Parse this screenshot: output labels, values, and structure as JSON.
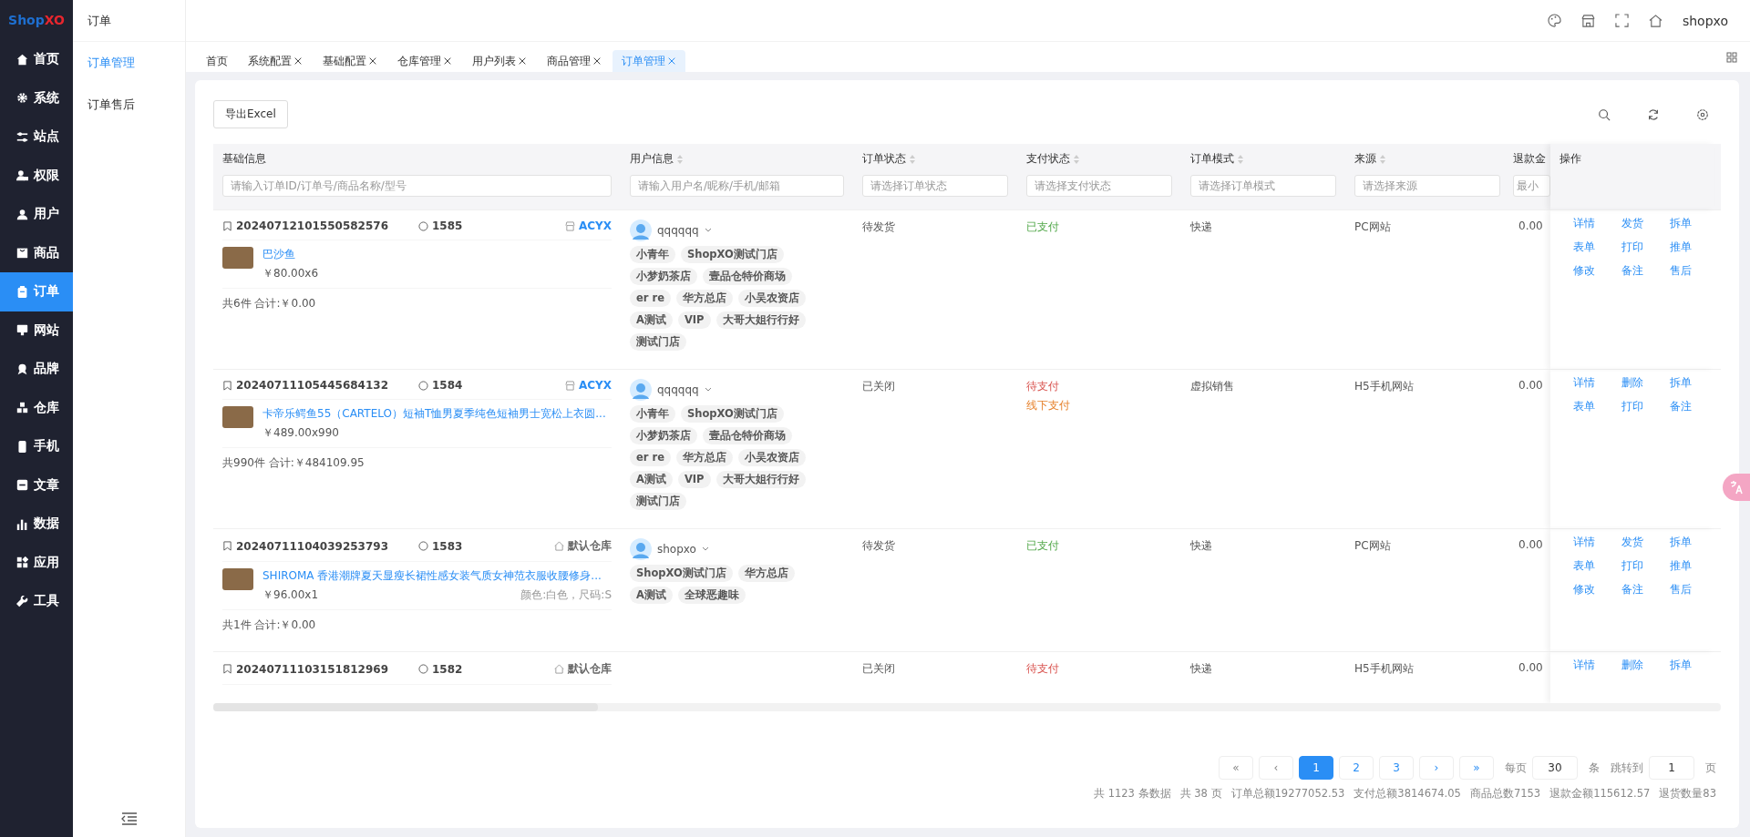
{
  "sidebar": {
    "logo": {
      "first": "Shop",
      "second": "XO"
    },
    "items": [
      {
        "label": "首页",
        "selected": false
      },
      {
        "label": "系统",
        "selected": false
      },
      {
        "label": "站点",
        "selected": false
      },
      {
        "label": "权限",
        "selected": false
      },
      {
        "label": "用户",
        "selected": false
      },
      {
        "label": "商品",
        "selected": false
      },
      {
        "label": "订单",
        "selected": true
      },
      {
        "label": "网站",
        "selected": false
      },
      {
        "label": "品牌",
        "selected": false
      },
      {
        "label": "仓库",
        "selected": false
      },
      {
        "label": "手机",
        "selected": false
      },
      {
        "label": "文章",
        "selected": false
      },
      {
        "label": "数据",
        "selected": false
      },
      {
        "label": "应用",
        "selected": false
      },
      {
        "label": "工具",
        "selected": false
      }
    ]
  },
  "subnav": {
    "title": "订单",
    "items": [
      {
        "label": "订单管理",
        "selected": true
      },
      {
        "label": "订单售后",
        "selected": false
      }
    ]
  },
  "header": {
    "user": "shopxo"
  },
  "tabs": [
    {
      "label": "首页",
      "closable": false,
      "selected": false
    },
    {
      "label": "系统配置",
      "closable": true,
      "selected": false
    },
    {
      "label": "基础配置",
      "closable": true,
      "selected": false
    },
    {
      "label": "仓库管理",
      "closable": true,
      "selected": false
    },
    {
      "label": "用户列表",
      "closable": true,
      "selected": false
    },
    {
      "label": "商品管理",
      "closable": true,
      "selected": false
    },
    {
      "label": "订单管理",
      "closable": true,
      "selected": true
    }
  ],
  "toolbar": {
    "export_button": "导出Excel"
  },
  "table": {
    "columns": [
      {
        "title": "基础信息",
        "sortable": false,
        "placeholder": "请输入订单ID/订单号/商品名称/型号"
      },
      {
        "title": "用户信息",
        "sortable": true,
        "placeholder": "请输入用户名/昵称/手机/邮箱"
      },
      {
        "title": "订单状态",
        "sortable": true,
        "placeholder": "请选择订单状态"
      },
      {
        "title": "支付状态",
        "sortable": true,
        "placeholder": "请选择支付状态"
      },
      {
        "title": "订单模式",
        "sortable": true,
        "placeholder": "请选择订单模式"
      },
      {
        "title": "来源",
        "sortable": true,
        "placeholder": "请选择来源"
      },
      {
        "title": "退款金",
        "sortable": false,
        "placeholder": "最小"
      },
      {
        "title": "操作",
        "sortable": false
      }
    ],
    "rows": [
      {
        "order_no": "20240712101550582576",
        "id": "1585",
        "warehouse": {
          "kind": "store",
          "name": "ACYX"
        },
        "goods": [
          {
            "title": "巴沙鱼",
            "price": "￥80.00x6"
          }
        ],
        "summary": "共6件 合计:￥0.00",
        "user": {
          "name": "qqqqqq",
          "tags": [
            "小青年",
            "ShopXO测试门店",
            "小梦奶茶店",
            "壹品仓特价商场",
            "er re",
            "华方总店",
            "小吴农资店",
            "A测试",
            "VIP",
            "大哥大姐行行好",
            "测试门店"
          ]
        },
        "status": "待发货",
        "payments": [
          {
            "text": "已支付",
            "color": "#52a84a"
          }
        ],
        "mode": "快递",
        "source": "PC网站",
        "refund": "0.00",
        "actions": [
          "详情",
          "发货",
          "拆单",
          "表单",
          "打印",
          "推单",
          "修改",
          "备注",
          "售后"
        ]
      },
      {
        "order_no": "20240711105445684132",
        "id": "1584",
        "warehouse": {
          "kind": "store",
          "name": "ACYX"
        },
        "goods": [
          {
            "title": "卡帝乐鳄鱼55（CARTELO）短袖T恤男夏季纯色短袖男士宽松上衣圆...",
            "price": "￥489.00x990"
          }
        ],
        "summary": "共990件 合计:￥484109.95",
        "user": {
          "name": "qqqqqq",
          "tags": [
            "小青年",
            "ShopXO测试门店",
            "小梦奶茶店",
            "壹品仓特价商场",
            "er re",
            "华方总店",
            "小吴农资店",
            "A测试",
            "VIP",
            "大哥大姐行行好",
            "测试门店"
          ]
        },
        "status": "已关闭",
        "payments": [
          {
            "text": "待支付",
            "color": "#d9534f"
          },
          {
            "text": "线下支付",
            "color": "#e6812b"
          }
        ],
        "mode": "虚拟销售",
        "source": "H5手机网站",
        "refund": "0.00",
        "actions": [
          "详情",
          "删除",
          "拆单",
          "表单",
          "打印",
          "备注"
        ]
      },
      {
        "order_no": "20240711104039253793",
        "id": "1583",
        "warehouse": {
          "kind": "house",
          "name": "默认仓库"
        },
        "goods": [
          {
            "title": "SHIROMA 香港潮牌夏天显瘦长裙性感女装气质女神范衣服收腰修身...",
            "price": "￥96.00x1",
            "spec": "颜色:白色，尺码:S"
          }
        ],
        "summary": "共1件 合计:￥0.00",
        "user": {
          "name": "shopxo",
          "tags": [
            "ShopXO测试门店",
            "华方总店",
            "A测试",
            "全球恶趣味"
          ]
        },
        "status": "待发货",
        "payments": [
          {
            "text": "已支付",
            "color": "#52a84a"
          }
        ],
        "mode": "快递",
        "source": "PC网站",
        "refund": "0.00",
        "actions": [
          "详情",
          "发货",
          "拆单",
          "表单",
          "打印",
          "推单",
          "修改",
          "备注",
          "售后"
        ]
      },
      {
        "order_no": "20240711103151812969",
        "id": "1582",
        "warehouse": {
          "kind": "house",
          "name": "默认仓库"
        },
        "status": "已关闭",
        "payments": [
          {
            "text": "待支付",
            "color": "#d9534f"
          }
        ],
        "mode": "快递",
        "source": "H5手机网站",
        "refund": "0.00",
        "actions": [
          "详情",
          "删除",
          "拆单"
        ]
      }
    ]
  },
  "pagination": {
    "buttons": [
      {
        "label": "«",
        "selected": false
      },
      {
        "label": "‹",
        "selected": false
      },
      {
        "label": "1",
        "selected": true
      },
      {
        "label": "2",
        "selected": false
      },
      {
        "label": "3",
        "selected": false
      },
      {
        "label": "›",
        "selected": false
      },
      {
        "label": "»",
        "selected": false
      }
    ],
    "per_page_label": "每页",
    "per_page": "30",
    "per_page_unit": "条",
    "jump_label": "跳转到",
    "jump_value": "1",
    "jump_unit": "页"
  },
  "summary": [
    "共 1123 条数据",
    "共 38 页",
    "订单总额19277052.53",
    "支付总额3814674.05",
    "商品总数7153",
    "退款金额115612.57",
    "退货数量83"
  ]
}
